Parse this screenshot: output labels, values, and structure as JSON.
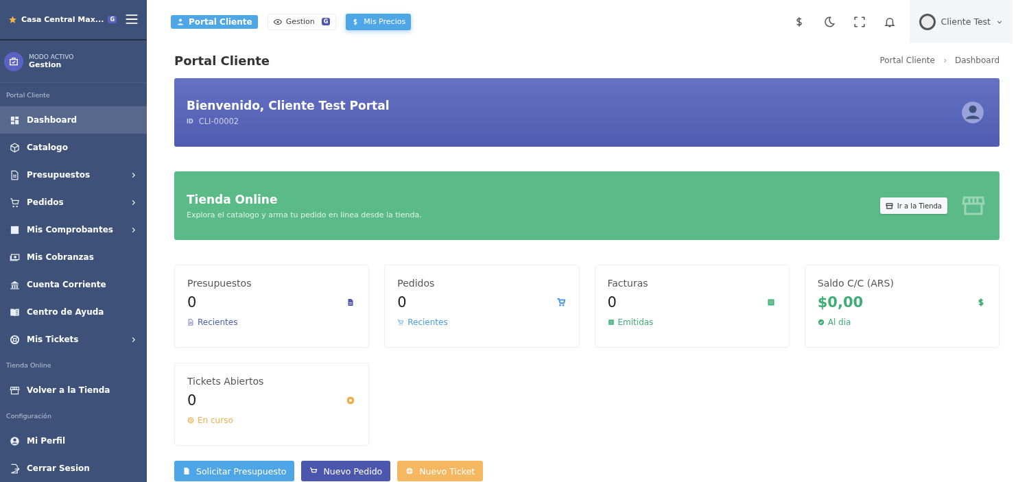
{
  "brand": {
    "name": "Casa Central Max...",
    "badge": "G"
  },
  "mode": {
    "label": "MODO ACTIVO",
    "value": "Gestion"
  },
  "sidebar": [
    {
      "kind": "section",
      "label": "Portal Cliente"
    },
    {
      "kind": "item",
      "label": "Dashboard",
      "selected": true,
      "expandable": false
    },
    {
      "kind": "item",
      "label": "Catalogo",
      "selected": false,
      "expandable": false
    },
    {
      "kind": "item",
      "label": "Presupuestos",
      "selected": false,
      "expandable": true
    },
    {
      "kind": "item",
      "label": "Pedidos",
      "selected": false,
      "expandable": true
    },
    {
      "kind": "item",
      "label": "Mis Comprobantes",
      "selected": false,
      "expandable": true
    },
    {
      "kind": "item",
      "label": "Mis Cobranzas",
      "selected": false,
      "expandable": false
    },
    {
      "kind": "item",
      "label": "Cuenta Corriente",
      "selected": false,
      "expandable": false
    },
    {
      "kind": "item",
      "label": "Centro de Ayuda",
      "selected": false,
      "expandable": false
    },
    {
      "kind": "item",
      "label": "Mis Tickets",
      "selected": false,
      "expandable": true
    },
    {
      "kind": "section",
      "label": "Tienda Online"
    },
    {
      "kind": "item",
      "label": "Volver a la Tienda",
      "selected": false,
      "expandable": false
    },
    {
      "kind": "section",
      "label": "Configuración"
    },
    {
      "kind": "item",
      "label": "Mi Perfil",
      "selected": false,
      "expandable": false
    },
    {
      "kind": "item",
      "label": "Cerrar Sesion",
      "selected": false,
      "expandable": false
    }
  ],
  "topbar": {
    "chips": [
      {
        "kind": "portal",
        "label": "Portal Cliente"
      },
      {
        "kind": "mode",
        "label": "Gestion",
        "badge": "G"
      },
      {
        "kind": "prices",
        "label": "Mis Precios"
      }
    ],
    "user": "Cliente Test"
  },
  "page": {
    "title": "Portal Cliente",
    "breadcrumb": [
      "Portal Cliente",
      "Dashboard"
    ]
  },
  "welcome": {
    "title": "Bienvenido, Cliente Test Portal",
    "id_label": "ID",
    "id": "CLI-00002"
  },
  "store": {
    "title": "Tienda Online",
    "text": "Explora el catalogo y arma tu pedido en linea desde la tienda.",
    "button": "Ir a la Tienda"
  },
  "stats": [
    {
      "title": "Presupuestos",
      "value": "0",
      "footer": "Recientes",
      "color": "#4f5bb0",
      "value_colored": false
    },
    {
      "title": "Pedidos",
      "value": "0",
      "footer": "Recientes",
      "color": "#4a9ee0",
      "value_colored": false
    },
    {
      "title": "Facturas",
      "value": "0",
      "footer": "Emitidas",
      "color": "#3fae74",
      "value_colored": false
    },
    {
      "title": "Saldo C/C (ARS)",
      "value": "$0,00",
      "footer": "Al dia",
      "color": "#3fae74",
      "value_colored": true
    },
    {
      "title": "Tickets Abiertos",
      "value": "0",
      "footer": "En curso",
      "color": "#f2ad4e",
      "value_colored": false
    }
  ],
  "actions": [
    {
      "label": "Solicitar Presupuesto",
      "color": "#4ea6e6"
    },
    {
      "label": "Nuevo Pedido",
      "color": "#4b56ad"
    },
    {
      "label": "Nuevo Ticket",
      "color": "#f5b860"
    }
  ]
}
